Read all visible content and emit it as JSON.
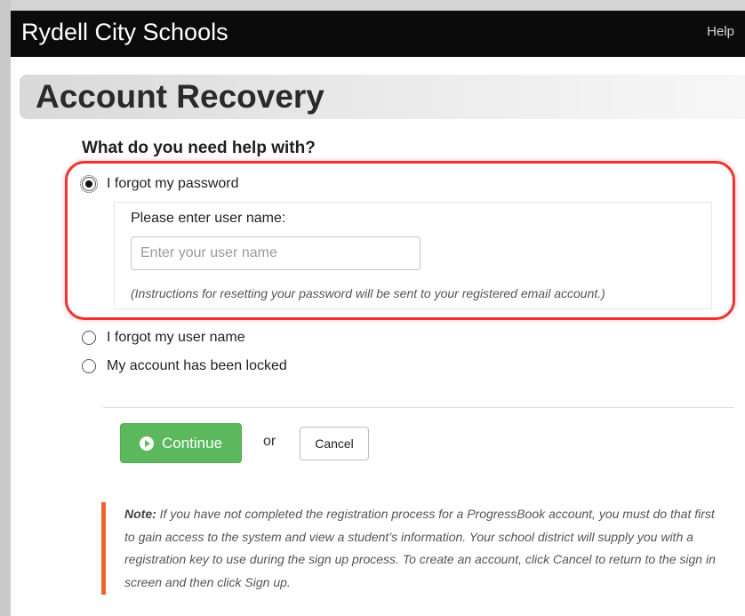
{
  "header": {
    "app_title": "Rydell City Schools",
    "help_label": "Help"
  },
  "page": {
    "title": "Account Recovery",
    "question": "What do you need help with?"
  },
  "options": [
    {
      "label": "I forgot my password",
      "selected": true
    },
    {
      "label": "I forgot my user name",
      "selected": false
    },
    {
      "label": "My account has been locked",
      "selected": false
    }
  ],
  "password_panel": {
    "label": "Please enter user name:",
    "input_value": "",
    "input_placeholder": "Enter your user name",
    "instructions": "(Instructions for resetting your password will be sent to your registered email account.)"
  },
  "actions": {
    "continue_label": "Continue",
    "or_label": "or",
    "cancel_label": "Cancel"
  },
  "note": {
    "label": "Note:",
    "text": "If you have not completed the registration process for a ProgressBook account, you must do that first to gain access to the system and view a student’s information. Your school district will supply you with a registration key to use during the sign up process. To create an account, click Cancel to return to the sign in screen and then click Sign up."
  },
  "colors": {
    "header_bg": "#0b0b0b",
    "continue_green": "#5cb85c",
    "highlight_red": "#e9342f",
    "note_accent": "#f0642a"
  },
  "icons": {
    "continue_icon": "arrow-circle-right-icon"
  }
}
